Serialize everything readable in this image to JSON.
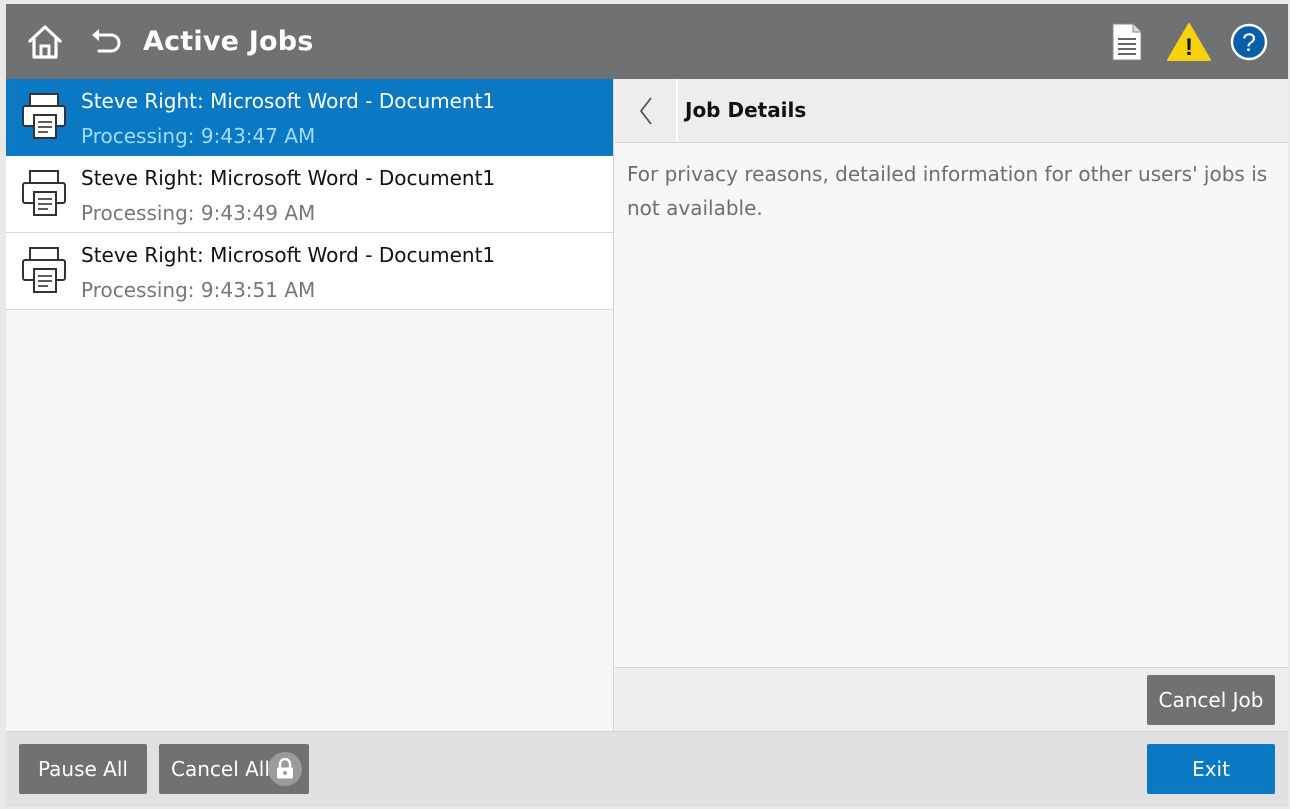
{
  "header": {
    "title": "Active Jobs",
    "icons": [
      "home-icon",
      "back-icon",
      "job-log-icon",
      "warning-icon",
      "help-icon"
    ],
    "warning_symbol": "!",
    "help_symbol": "?"
  },
  "jobs": [
    {
      "name": "Steve Right: Microsoft Word - Document1",
      "status": "Processing: 9:43:47 AM",
      "selected": true
    },
    {
      "name": "Steve Right: Microsoft Word - Document1",
      "status": "Processing: 9:43:49 AM",
      "selected": false
    },
    {
      "name": "Steve Right: Microsoft Word - Document1",
      "status": "Processing: 9:43:51 AM",
      "selected": false
    }
  ],
  "details": {
    "title": "Job Details",
    "message": "For privacy reasons, detailed information for other users' jobs is not available.",
    "cancel_job_label": "Cancel Job"
  },
  "bottom": {
    "pause_all_label": "Pause All",
    "cancel_all_label": "Cancel All",
    "exit_label": "Exit"
  },
  "colors": {
    "header": "#707173",
    "selected": "#0a78c2",
    "selected_status": "#9fdcff",
    "button": "#707173",
    "primary_button": "#0a78c2",
    "warning": "#f5d20b"
  }
}
